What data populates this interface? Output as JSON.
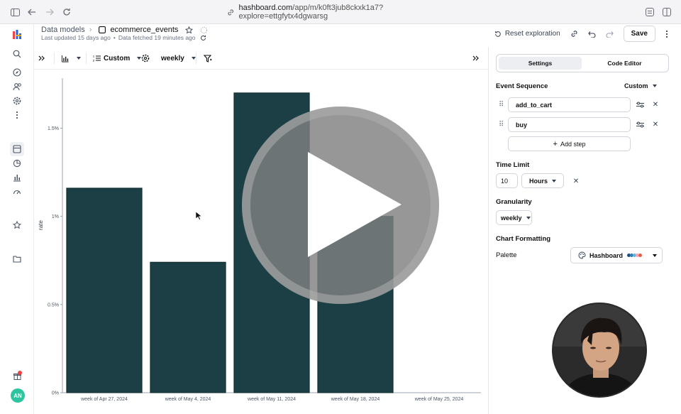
{
  "browser": {
    "url_domain": "hashboard.com",
    "url_path": "/app/m/k0ft3jub8ckxk1a7?explore=ettgfytx4dgwarsg"
  },
  "header": {
    "breadcrumb_parent": "Data models",
    "breadcrumb_current": "ecommerce_events",
    "last_updated": "Last updated 15 days ago",
    "data_fetched": "Data fetched 19 minutes ago",
    "reset_label": "Reset exploration",
    "save_label": "Save"
  },
  "toolbar": {
    "metric_label": "Custom",
    "granularity_label": "weekly"
  },
  "panel": {
    "tabs": [
      {
        "label": "Settings",
        "selected": true
      },
      {
        "label": "Code Editor",
        "selected": false
      }
    ],
    "event_sequence_title": "Event Sequence",
    "event_sequence_mode": "Custom",
    "steps": [
      "add_to_cart",
      "buy"
    ],
    "add_step_label": "Add step",
    "time_limit_title": "Time Limit",
    "time_limit_value": "10",
    "time_limit_unit": "Hours",
    "granularity_title": "Granularity",
    "granularity_value": "weekly",
    "chart_formatting_title": "Chart Formatting",
    "palette_label": "Palette",
    "palette_value": "Hashboard",
    "palette_colors": [
      "#1f4e79",
      "#2f7fbf",
      "#5fb7d9",
      "#f4a3b6",
      "#e85d4a"
    ]
  },
  "user": {
    "initials": "AN"
  },
  "chart_data": {
    "type": "bar",
    "categories": [
      "week of Apr 27, 2024",
      "week of May 4, 2024",
      "week of May 11, 2024",
      "week of May 18, 2024",
      "week of May 25, 2024"
    ],
    "values": [
      1.16,
      0.74,
      1.7,
      1.0,
      null
    ],
    "ylabel": "rate",
    "ylim": [
      0,
      1.8
    ],
    "yticks": [
      0,
      0.5,
      1,
      1.5
    ],
    "ytick_labels": [
      "0%",
      "0.5%",
      "1%",
      "1.5%"
    ],
    "bar_color": "#1b3f44",
    "grid": false
  }
}
